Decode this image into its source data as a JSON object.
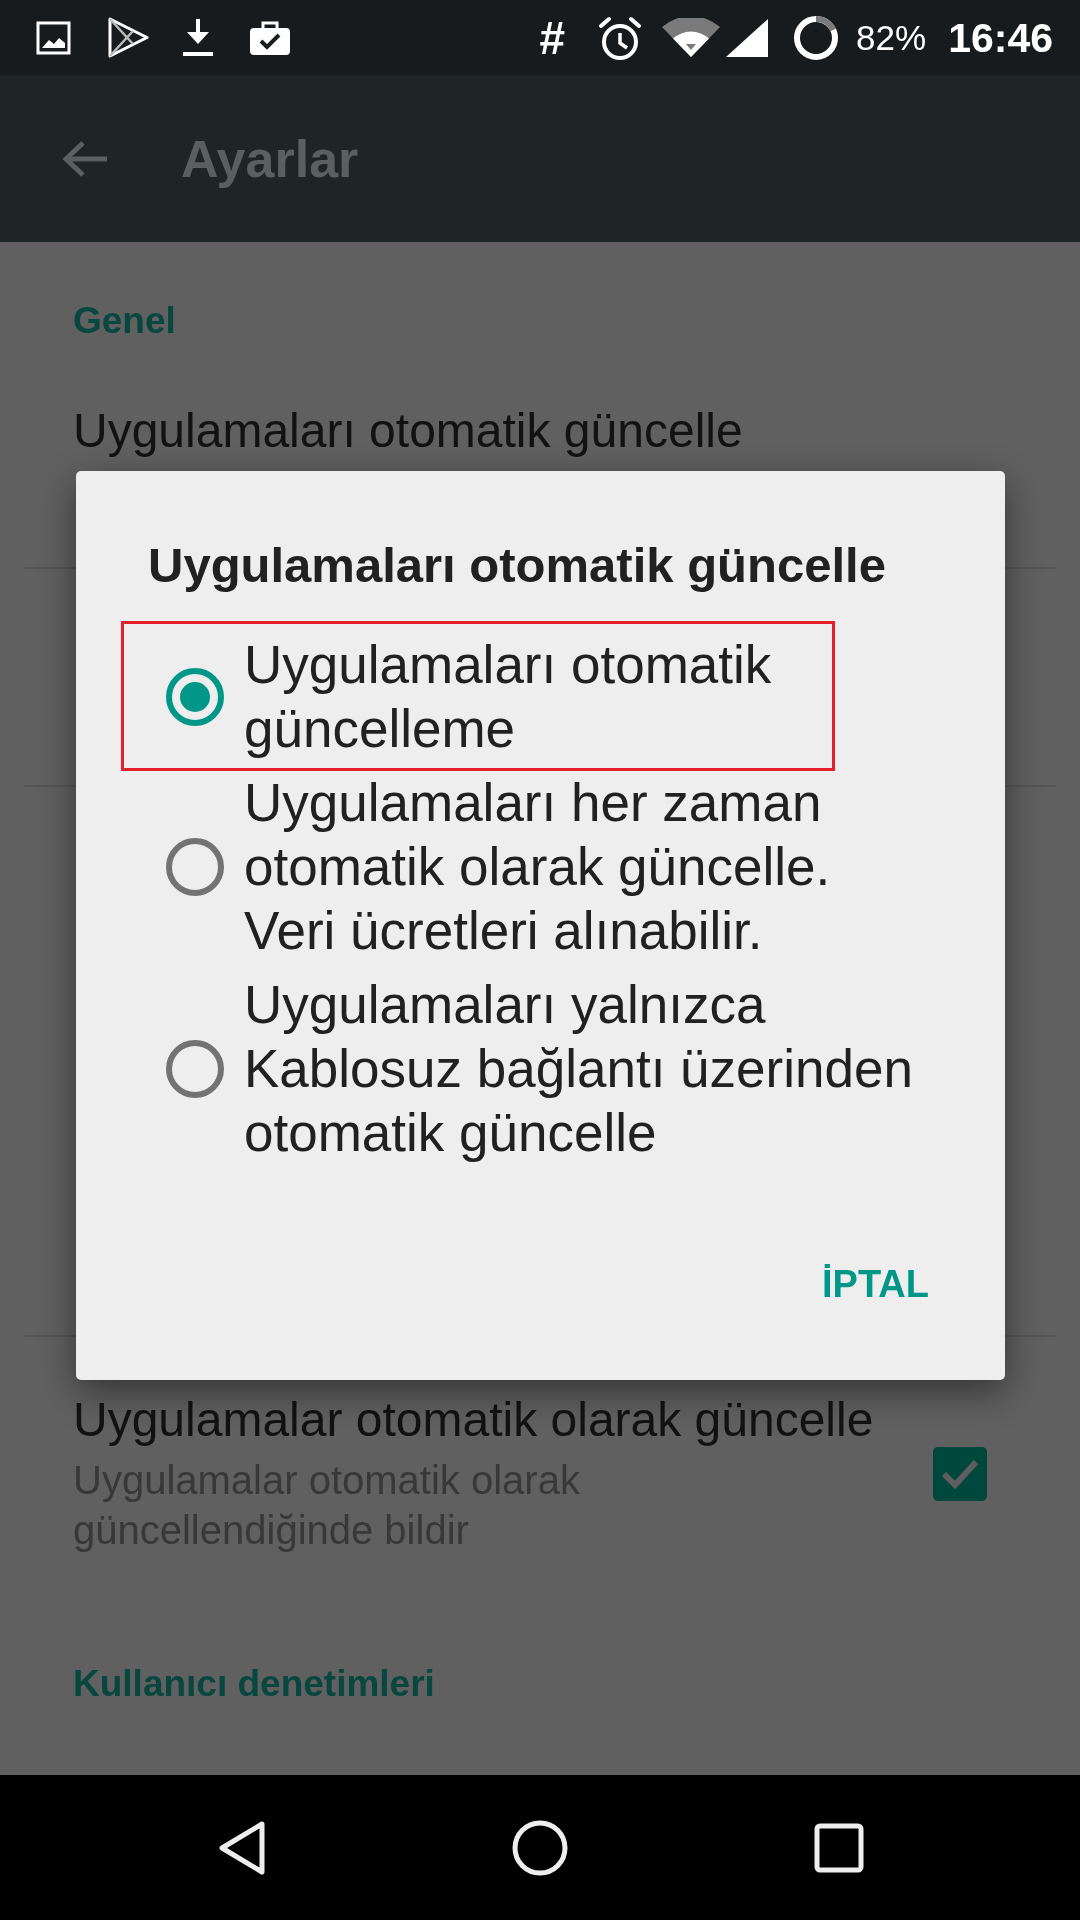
{
  "status_bar": {
    "symbol": "#",
    "battery_percent": "82%",
    "time": "16:46"
  },
  "app_bar": {
    "title": "Ayarlar"
  },
  "settings": {
    "sections": [
      {
        "header": "Genel",
        "items": [
          {
            "kind": "plain",
            "title": "Uygulamaları otomatik güncelle"
          },
          {
            "kind": "checkbox",
            "title": "Uygulamalar otomatik olarak güncelle",
            "summary": "Uygulamalar otomatik olarak güncellendiğinde bildir",
            "checked": true
          }
        ]
      },
      {
        "header": "Kullanıcı denetimleri"
      }
    ]
  },
  "dialog": {
    "title": "Uygulamaları otomatik güncelle",
    "options": [
      {
        "label": "Uygulamaları otomatik güncelleme",
        "selected": true,
        "highlighted": true
      },
      {
        "label": "Uygulamaları her zaman otomatik olarak güncelle. Veri ücretleri alınabilir.",
        "selected": false,
        "highlighted": false
      },
      {
        "label": "Uygulamaları yalnızca Kablosuz bağlantı üzerinden otomatik güncelle",
        "selected": false,
        "highlighted": false
      }
    ],
    "buttons": [
      "İPTAL"
    ]
  }
}
